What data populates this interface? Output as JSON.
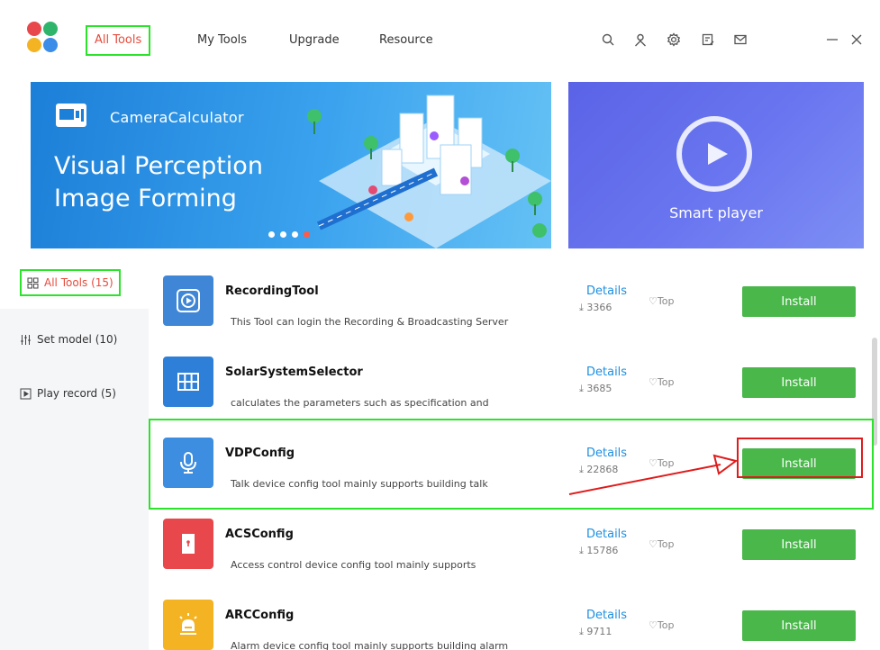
{
  "header": {
    "nav": [
      {
        "label": "All Tools",
        "active": true
      },
      {
        "label": "My Tools",
        "active": false
      },
      {
        "label": "Upgrade",
        "active": false
      },
      {
        "label": "Resource",
        "active": false
      }
    ],
    "icons": [
      "search-icon",
      "user-icon",
      "gear-icon",
      "notes-icon",
      "mail-icon",
      "minimize-icon",
      "close-icon"
    ],
    "logo_colors": [
      "#e8474b",
      "#2fb56b",
      "#f4b323",
      "#3b8de8"
    ]
  },
  "banner": {
    "subtitle": "CameraCalculator",
    "title_line1": "Visual Perception",
    "title_line2": "Image Forming",
    "side_label": "Smart player"
  },
  "sidebar": {
    "items": [
      {
        "label": "All Tools (15)",
        "icon": "grid-icon",
        "active": true
      },
      {
        "label": "Set model (10)",
        "icon": "sliders-icon",
        "active": false
      },
      {
        "label": "Play record (5)",
        "icon": "play-box-icon",
        "active": false
      }
    ]
  },
  "tools": [
    {
      "name": "RecordingTool",
      "description": "This Tool can login the Recording & Broadcasting Server",
      "details_label": "Details",
      "downloads": "3366",
      "top_label": "Top",
      "install_label": "Install",
      "icon": "record-icon",
      "color": "#3f87d6"
    },
    {
      "name": "SolarSystemSelector",
      "description": "calculates the parameters such as specification and",
      "details_label": "Details",
      "downloads": "3685",
      "top_label": "Top",
      "install_label": "Install",
      "icon": "solar-panel-icon",
      "color": "#2e7fd7"
    },
    {
      "name": "VDPConfig",
      "description": "Talk device config tool mainly supports building talk",
      "details_label": "Details",
      "downloads": "22868",
      "top_label": "Top",
      "install_label": "Install",
      "icon": "microphone-icon",
      "color": "#3d8de0"
    },
    {
      "name": "ACSConfig",
      "description": "Access control device config tool mainly supports",
      "details_label": "Details",
      "downloads": "15786",
      "top_label": "Top",
      "install_label": "Install",
      "icon": "door-icon",
      "color": "#e8474b"
    },
    {
      "name": "ARCConfig",
      "description": "Alarm device config tool mainly supports building alarm",
      "details_label": "Details",
      "downloads": "9711",
      "top_label": "Top",
      "install_label": "Install",
      "icon": "alarm-icon",
      "color": "#f4b323"
    }
  ],
  "colors": {
    "accent_active": "#e64b3c",
    "install": "#49b74a",
    "details_link": "#1d8fe0",
    "highlight_green": "#2be32b",
    "highlight_red": "#e01b1b"
  }
}
